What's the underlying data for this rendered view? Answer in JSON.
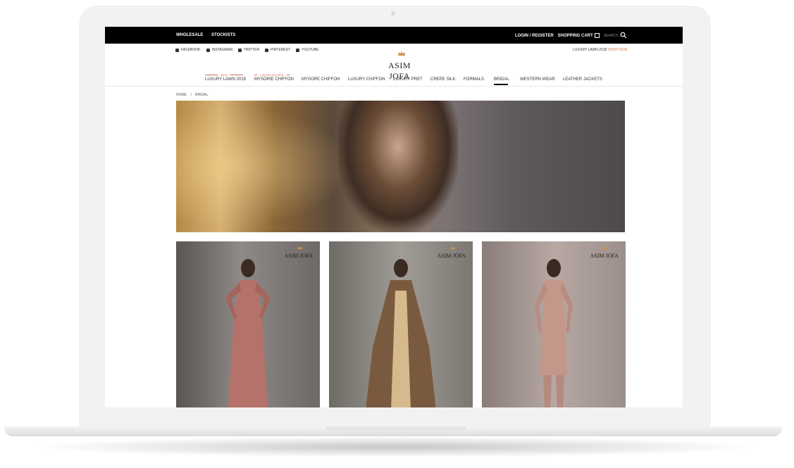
{
  "topbar": {
    "wholesale": "WHOLESALE",
    "stockists": "STOCKISTS",
    "login": "LOGIN / REGISTER",
    "cart": "SHOPPING CART",
    "search_placeholder": "SEARCH..."
  },
  "social": {
    "facebook": "FACEBOOK",
    "instagram": "INSTAGRAM",
    "twitter": "TWITTER",
    "pinterest": "PINTEREST",
    "youtube": "YOUTUBE"
  },
  "promo": {
    "text": "LUXURY LAWN 2018",
    "link": "SHOP NOW"
  },
  "logo": {
    "text": "ASIM JOFA"
  },
  "nav": {
    "items": [
      {
        "label": "LUXURY LAWN 2018",
        "tag": "NEW"
      },
      {
        "label": "MYSORIE CHIFFON",
        "tag": "LIMITED EDITION"
      },
      {
        "label": "MYSORE CHIFFON"
      },
      {
        "label": "LUXURY CHIFFON"
      },
      {
        "label": "LUXURY PRET"
      },
      {
        "label": "CREPE SILK"
      },
      {
        "label": "FORMALS"
      },
      {
        "label": "BRIDAL",
        "active": true
      },
      {
        "label": "WESTERN WEAR"
      },
      {
        "label": "LEATHER JACKETS"
      }
    ]
  },
  "breadcrumb": {
    "home": "HOME",
    "sep": "/",
    "current": "BRIDAL"
  },
  "products": [
    {
      "logo": "ASIM JOFA"
    },
    {
      "logo": "ASIM JOFA"
    },
    {
      "logo": "ASIM JOFA"
    }
  ],
  "colors": {
    "accent": "#d77b56",
    "topbar_bg": "#000000"
  }
}
